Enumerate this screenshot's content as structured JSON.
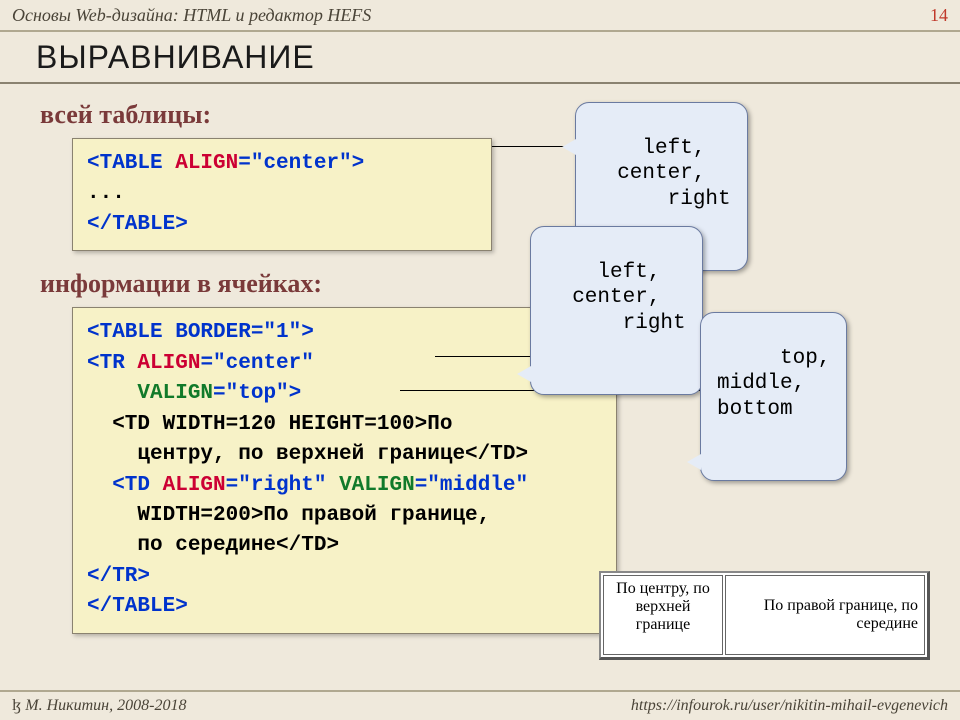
{
  "header": {
    "breadcrumb": "Основы Web-дизайна: HTML и редактор HEFS",
    "page": "14"
  },
  "title": "ВЫРАВНИВАНИЕ",
  "sub1": "всей таблицы:",
  "sub2": "информации в ячейках:",
  "code1": {
    "l1a": "<TABLE ",
    "l1b": "ALIGN",
    "l1c": "=\"center\">",
    "l2": "...",
    "l3": "</TABLE>"
  },
  "code2": {
    "l1": "<TABLE BORDER=\"1\">",
    "l2a": "<TR ",
    "l2b": "ALIGN",
    "l2c": "=\"center\"",
    "l3a": "    ",
    "l3b": "VALIGN",
    "l3c": "=\"top\">",
    "l4": "  <TD WIDTH=120 HEIGHT=100>По",
    "l5": "    центру, по верхней границе</TD>",
    "l6a": "  <TD ",
    "l6b": "ALIGN",
    "l6c": "=\"right\" ",
    "l6d": "VALIGN",
    "l6e": "=\"middle\"",
    "l7": "    WIDTH=200>По правой границе,",
    "l8": "    по середине</TD>",
    "l9": "</TR>",
    "l10": "</TABLE>"
  },
  "callout_align": "left,\n  center,\n      right",
  "callout_align2": "left,\n  center,\n      right",
  "callout_valign": " top,\nmiddle,\nbottom",
  "example": {
    "cell1": "По центру, по\nверхней\nгранице",
    "cell2": "По правой границе, по\nсередине"
  },
  "footer": {
    "author": "М. Никитин, 2008-2018",
    "url": "https://infourok.ru/user/nikitin-mihail-evgenevich"
  }
}
